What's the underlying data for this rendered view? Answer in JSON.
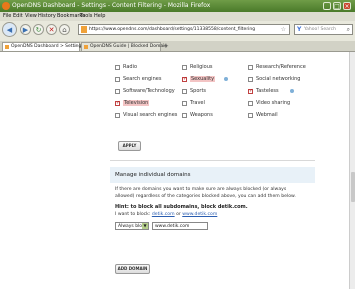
{
  "window": {
    "title": "OpenDNS Dashboard - Settings - Content Filtering - Mozilla Firefox"
  },
  "menu": [
    "File",
    "Edit",
    "View",
    "History",
    "Bookmarks",
    "Tools",
    "Help"
  ],
  "nav": {
    "url": "https://www.opendns.com/dashboard/settings/11338558/content_filtering",
    "search_placeholder": "Yahoo! Search"
  },
  "tabs": [
    {
      "label": "OpenDNS Dashboard > Settings > ..."
    },
    {
      "label": "OpenDNS Guide | Blocked Domain"
    }
  ],
  "categories": [
    {
      "label": "Radio",
      "checked": false
    },
    {
      "label": "Religious",
      "checked": false
    },
    {
      "label": "Research/Reference",
      "checked": false
    },
    {
      "label": "Search engines",
      "checked": false
    },
    {
      "label": "Sexuality",
      "checked": true,
      "info": true
    },
    {
      "label": "Social networking",
      "checked": false
    },
    {
      "label": "Software/Technology",
      "checked": false
    },
    {
      "label": "Sports",
      "checked": false
    },
    {
      "label": "Tasteless",
      "checked": true,
      "info": true
    },
    {
      "label": "Television",
      "checked": true
    },
    {
      "label": "Travel",
      "checked": false
    },
    {
      "label": "Video sharing",
      "checked": false
    },
    {
      "label": "Visual search engines",
      "checked": false
    },
    {
      "label": "Weapons",
      "checked": false
    },
    {
      "label": "Webmail",
      "checked": false
    }
  ],
  "apply_label": "APPLY",
  "domains": {
    "heading": "Manage individual domains",
    "description": "If there are domains you want to make sure are always blocked (or always allowed) regardless of the categories blocked above, you can add them below.",
    "hint": "Hint: to block all subdomains, block detik.com.",
    "example_prefix": "I want to block:",
    "example_link1": "detik.com",
    "example_or": "or",
    "example_link2": "www.detik.com",
    "mode_value": "Always block",
    "domain_value": "www.detik.com",
    "add_label": "ADD DOMAIN"
  }
}
